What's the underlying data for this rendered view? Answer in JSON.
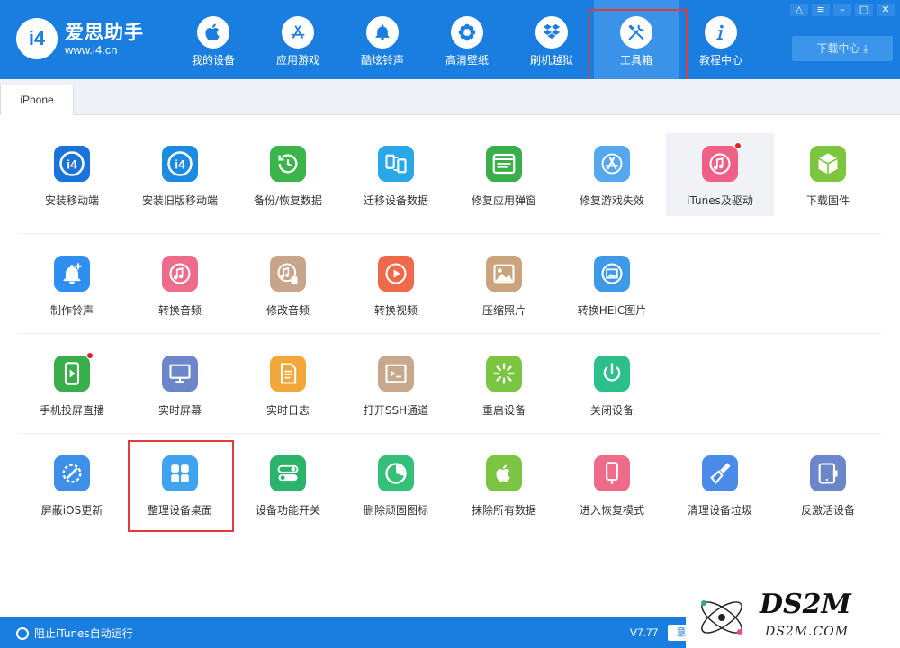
{
  "app": {
    "logo_mark": "i4",
    "logo_title": "爱思助手",
    "logo_url": "www.i4.cn"
  },
  "nav": [
    {
      "label": "我的设备",
      "icon": "apple-icon"
    },
    {
      "label": "应用游戏",
      "icon": "app-store-icon"
    },
    {
      "label": "酷炫铃声",
      "icon": "bell-icon"
    },
    {
      "label": "高清壁纸",
      "icon": "flower-icon"
    },
    {
      "label": "刷机越狱",
      "icon": "dropbox-icon"
    },
    {
      "label": "工具箱",
      "icon": "tools-icon",
      "active": true
    },
    {
      "label": "教程中心",
      "icon": "info-icon"
    }
  ],
  "window": {
    "download_center": "下载中心"
  },
  "tabs": [
    {
      "label": "iPhone"
    }
  ],
  "tools": [
    [
      {
        "label": "安装移动端",
        "color": "#1a73d9",
        "icon": "i4-logo-icon"
      },
      {
        "label": "安装旧版移动端",
        "color": "#1a8be0",
        "icon": "i4-logo-icon"
      },
      {
        "label": "备份/恢复数据",
        "color": "#3bb54a",
        "icon": "backup-restore-icon"
      },
      {
        "label": "迁移设备数据",
        "color": "#2aa7e6",
        "icon": "migrate-devices-icon"
      },
      {
        "label": "修复应用弹窗",
        "color": "#3aae4b",
        "icon": "apple-id-card-icon"
      },
      {
        "label": "修复游戏失效",
        "color": "#55a8ee",
        "icon": "app-store-wrench-icon"
      },
      {
        "label": "iTunes及驱动",
        "color": "#ef5f86",
        "icon": "itunes-music-icon",
        "badge": true,
        "highlight": true
      },
      {
        "label": "下载固件",
        "color": "#7cc63f",
        "icon": "cube-icon"
      }
    ],
    [
      {
        "label": "制作铃声",
        "color": "#2f8ff0",
        "icon": "bell-plus-icon"
      },
      {
        "label": "转换音频",
        "color": "#ee6b8a",
        "icon": "music-note-icon"
      },
      {
        "label": "修改音频",
        "color": "#c7a58a",
        "icon": "music-edit-icon"
      },
      {
        "label": "转换视频",
        "color": "#ef6a4a",
        "icon": "play-circle-icon"
      },
      {
        "label": "压缩照片",
        "color": "#c9a47d",
        "icon": "photo-icon"
      },
      {
        "label": "转换HEIC图片",
        "color": "#3e9ae8",
        "icon": "heic-photo-icon"
      }
    ],
    [
      {
        "label": "手机投屏直播",
        "color": "#3aae4b",
        "icon": "phone-cast-icon",
        "badge": true
      },
      {
        "label": "实时屏幕",
        "color": "#6b86c9",
        "icon": "monitor-icon"
      },
      {
        "label": "实时日志",
        "color": "#f2a73b",
        "icon": "document-icon"
      },
      {
        "label": "打开SSH通道",
        "color": "#c8a88d",
        "icon": "terminal-icon"
      },
      {
        "label": "重启设备",
        "color": "#7bc542",
        "icon": "loading-spinner-icon"
      },
      {
        "label": "关闭设备",
        "color": "#2bbf8a",
        "icon": "power-icon"
      }
    ],
    [
      {
        "label": "屏蔽iOS更新",
        "color": "#3e8fe8",
        "icon": "block-gear-icon"
      },
      {
        "label": "整理设备桌面",
        "color": "#3fa3f0",
        "icon": "grid-icon",
        "boxed": true
      },
      {
        "label": "设备功能开关",
        "color": "#2bb36a",
        "icon": "toggle-switch-icon"
      },
      {
        "label": "删除顽固图标",
        "color": "#35c07a",
        "icon": "pie-clock-icon"
      },
      {
        "label": "抹除所有数据",
        "color": "#7bc542",
        "icon": "apple-icon"
      },
      {
        "label": "进入恢复模式",
        "color": "#ee6b8a",
        "icon": "phone-cable-icon"
      },
      {
        "label": "清理设备垃圾",
        "color": "#4a8bea",
        "icon": "broom-icon"
      },
      {
        "label": "反激活设备",
        "color": "#6b86c9",
        "icon": "tablet-icon"
      }
    ]
  ],
  "statusbar": {
    "itunes_toggle": "阻止iTunes自动运行",
    "version": "V7.77",
    "feedback": "意"
  },
  "watermark": {
    "text": "DS2M",
    "url": "DS2M.COM"
  }
}
